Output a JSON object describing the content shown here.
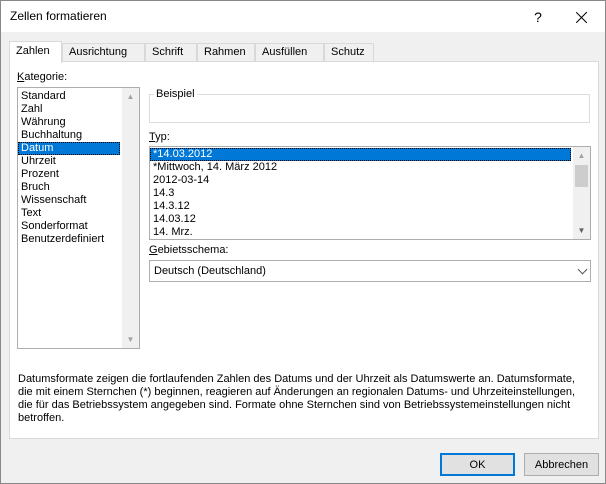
{
  "window": {
    "title": "Zellen formatieren",
    "help_glyph": "?"
  },
  "tabs": [
    {
      "label": "Zahlen",
      "active": true
    },
    {
      "label": "Ausrichtung"
    },
    {
      "label": "Schrift"
    },
    {
      "label": "Rahmen"
    },
    {
      "label": "Ausfüllen"
    },
    {
      "label": "Schutz"
    }
  ],
  "kategorie": {
    "label_prefix": "K",
    "label_rest": "ategorie:",
    "selected": "Datum",
    "items": [
      "Standard",
      "Zahl",
      "Währung",
      "Buchhaltung",
      "Datum",
      "Uhrzeit",
      "Prozent",
      "Bruch",
      "Wissenschaft",
      "Text",
      "Sonderformat",
      "Benutzerdefiniert"
    ]
  },
  "beispiel": {
    "title": "Beispiel",
    "value": ""
  },
  "typ": {
    "label_prefix": "T",
    "label_rest": "yp:",
    "selected": "*14.03.2012",
    "items": [
      "*14.03.2012",
      "*Mittwoch, 14. März 2012",
      "2012-03-14",
      "14.3",
      "14.3.12",
      "14.03.12",
      "14. Mrz."
    ]
  },
  "gebietsschema": {
    "label_prefix": "G",
    "label_rest": "ebietsschema:",
    "value": "Deutsch (Deutschland)"
  },
  "description": "Datumsformate zeigen die fortlaufenden Zahlen des Datums und der Uhrzeit als Datumswerte an. Datumsformate, die mit einem Sternchen (*) beginnen, reagieren auf Änderungen an regionalen Datums- und Uhrzeiteinstellungen, die für das Betriebssystem angegeben sind. Formate ohne Sternchen sind von Betriebssystemeinstellungen nicht betroffen.",
  "buttons": {
    "ok": "OK",
    "cancel": "Abbrechen"
  },
  "colors": {
    "selection": "#0078d7",
    "dialog_bg": "#f0f0f0"
  }
}
